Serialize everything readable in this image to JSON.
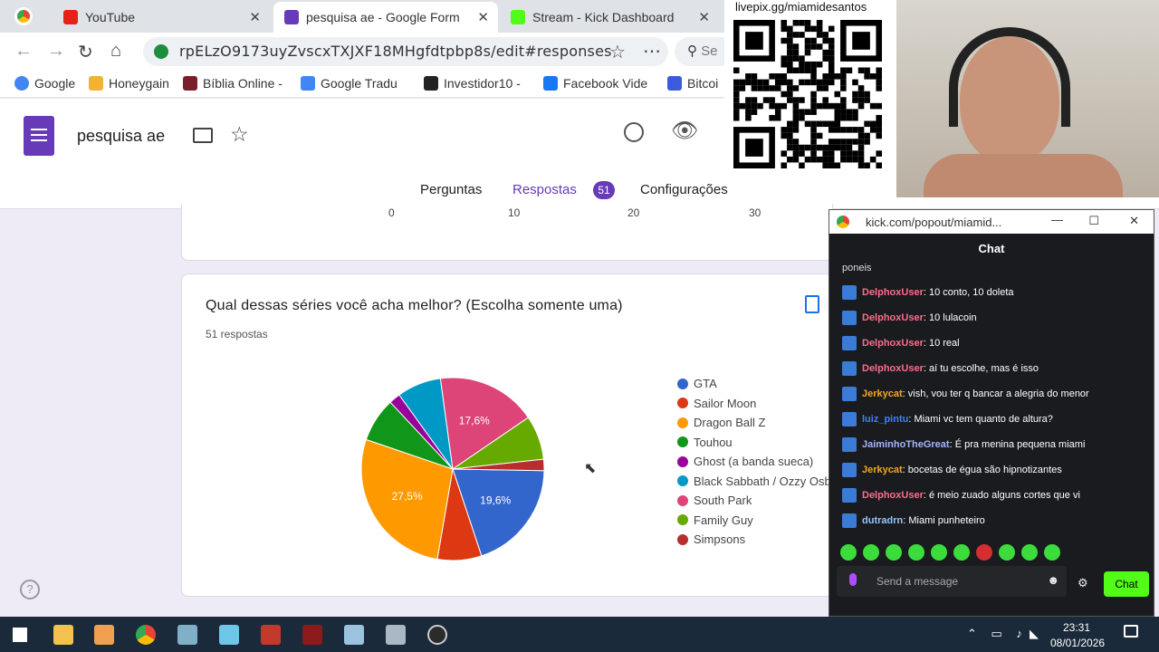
{
  "browser": {
    "tabs": [
      {
        "title": "YouTube",
        "active": false
      },
      {
        "title": "pesquisa ae - Google Form",
        "active": true
      },
      {
        "title": "Stream - Kick Dashboard",
        "active": false
      }
    ],
    "url": "rpELzO9173uyZvscxTXJXF18MHgfdtpbp8s/edit#responses",
    "search_stub": "Se",
    "bookmarks": [
      "Google",
      "Honeygain",
      "Bíblia Online -",
      "Google Tradu",
      "Investidor10 -",
      "Facebook Vide",
      "Bitcoi"
    ]
  },
  "forms": {
    "title": "pesquisa ae",
    "tabs": {
      "questions": "Perguntas",
      "responses": "Respostas",
      "responses_count": "51",
      "settings": "Configurações"
    },
    "prev_axis_ticks": [
      "0",
      "10",
      "20",
      "30"
    ],
    "question": "Qual dessas séries você acha melhor? (Escolha somente uma)",
    "response_count_label": "51 respostas",
    "help_icon": "help-circle-icon"
  },
  "chart_data": {
    "type": "pie",
    "categories": [
      "GTA",
      "Sailor Moon",
      "Dragon Ball Z",
      "Touhou",
      "Ghost (a banda sueca)",
      "Black Sabbath / Ozzy Osb",
      "South Park",
      "Family Guy",
      "Simpsons"
    ],
    "values": [
      19.6,
      7.8,
      27.5,
      7.8,
      2.0,
      7.8,
      17.6,
      7.8,
      2.0
    ],
    "colors": [
      "#3366cc",
      "#dc3912",
      "#ff9900",
      "#109618",
      "#990099",
      "#0099c6",
      "#dd4477",
      "#66aa00",
      "#b82e2e"
    ],
    "data_labels": [
      "19,6%",
      "27,5%",
      "17,6%"
    ],
    "legend_placement": "right"
  },
  "overlay": {
    "livepix": "livepix.gg/miamidesantos"
  },
  "chat": {
    "window_title": "kick.com/popout/miamid...",
    "header": "Chat",
    "truncated_top": "poneis",
    "messages": [
      {
        "user": "DelphoxUser",
        "color": "#ff6b8a",
        "text": ": 10 conto, 10 doleta"
      },
      {
        "user": "DelphoxUser",
        "color": "#ff6b8a",
        "text": ": 10 lulacoin"
      },
      {
        "user": "DelphoxUser",
        "color": "#ff6b8a",
        "text": ": 10 real"
      },
      {
        "user": "DelphoxUser",
        "color": "#ff6b8a",
        "text": ": aí tu escolhe, mas é isso"
      },
      {
        "user": "Jerkycat",
        "color": "#f5a623",
        "text": ": vish, vou ter q bancar a alegria do menor"
      },
      {
        "user": "luiz_pintu",
        "color": "#3b82f6",
        "text": ": Miami vc tem quanto de altura?"
      },
      {
        "user": "JaiminhoTheGreat",
        "color": "#a5b4fc",
        "text": ": É pra menina pequena miami"
      },
      {
        "user": "Jerkycat",
        "color": "#f5a623",
        "text": ": bocetas de égua são hipnotizantes"
      },
      {
        "user": "DelphoxUser",
        "color": "#ff6b8a",
        "text": ": é meio zuado alguns cortes que vi"
      },
      {
        "user": "dutradrn",
        "color": "#93c5fd",
        "text": ": Miami punheteiro"
      }
    ],
    "input_placeholder": "Send a message",
    "send_label": "Chat"
  },
  "taskbar": {
    "time": "23:31",
    "date": "08/01/2026"
  }
}
